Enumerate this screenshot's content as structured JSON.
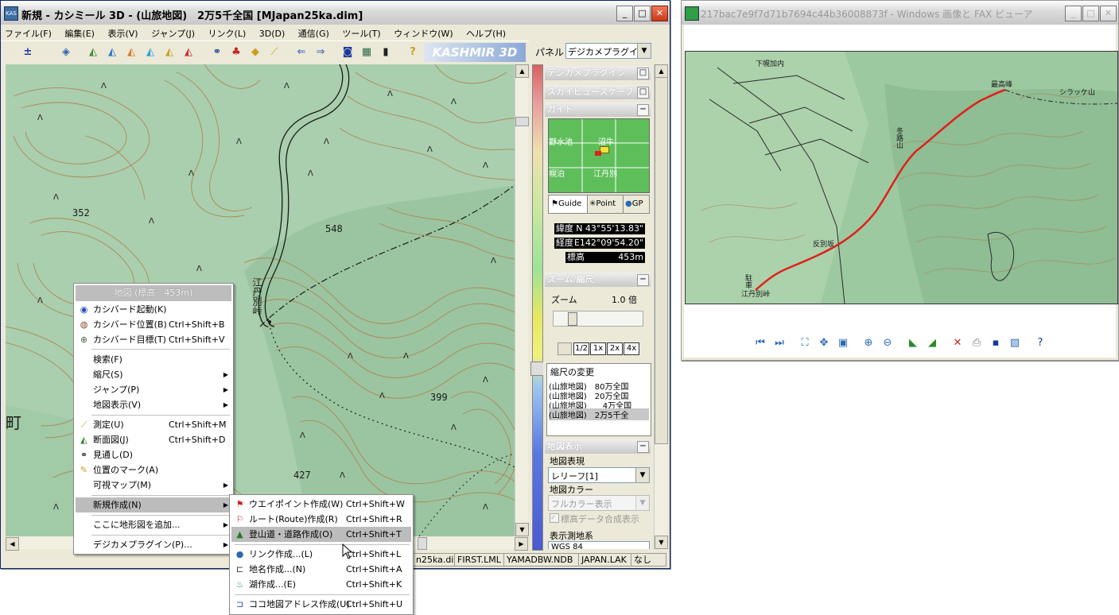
{
  "main_window": {
    "title": "新規 - カシミール 3D - (山旅地図)　2万5千全国 [MJapan25ka.dim]",
    "app_icon_text": "KAS",
    "menu": [
      "ファイル(F)",
      "編集(E)",
      "表示(V)",
      "ジャンプ(J)",
      "リンク(L)",
      "3D(D)",
      "通信(G)",
      "ツール(T)",
      "ウィンドウ(W)",
      "ヘルプ(H)"
    ],
    "brand": "KASHMIR 3D",
    "panel_label": "パネル",
    "panel_select": "デジカメプラグイ"
  },
  "map": {
    "labels": {
      "elev_352": "352",
      "elev_548": "548",
      "elev_399": "399",
      "elev_427": "427",
      "pass_name": "江丹別峠",
      "town": "町"
    }
  },
  "context_menu": {
    "header": "地図 (標高　453m)",
    "items": [
      {
        "label": "カシバード起動(K)",
        "shortcut": "",
        "icon": "bird-icon"
      },
      {
        "label": "カシバード位置(B)",
        "shortcut": "Ctrl+Shift+B",
        "icon": "camera-icon"
      },
      {
        "label": "カシバード目標(T)",
        "shortcut": "Ctrl+Shift+V",
        "icon": "target-icon"
      },
      {
        "label": "検索(F)",
        "shortcut": "",
        "icon": ""
      },
      {
        "label": "縮尺(S)",
        "shortcut": "",
        "icon": ""
      },
      {
        "label": "ジャンプ(P)",
        "shortcut": "",
        "icon": ""
      },
      {
        "label": "地図表示(V)",
        "shortcut": "",
        "icon": ""
      },
      {
        "label": "測定(U)",
        "shortcut": "Ctrl+Shift+M",
        "icon": "ruler-icon"
      },
      {
        "label": "断面図(J)",
        "shortcut": "Ctrl+Shift+D",
        "icon": "profile-icon"
      },
      {
        "label": "見通し(D)",
        "shortcut": "",
        "icon": "binoculars-icon"
      },
      {
        "label": "位置のマーク(A)",
        "shortcut": "",
        "icon": "pencil-icon"
      },
      {
        "label": "可視マップ(M)",
        "shortcut": "",
        "icon": ""
      },
      {
        "label": "新規作成(N)",
        "shortcut": "",
        "icon": ""
      },
      {
        "label": "ここに地形図を追加...",
        "shortcut": "",
        "icon": ""
      },
      {
        "label": "デジカメプラグイン(P)...",
        "shortcut": "",
        "icon": ""
      }
    ]
  },
  "submenu": {
    "items": [
      {
        "label": "ウエイポイント作成(W)",
        "shortcut": "Ctrl+Shift+W"
      },
      {
        "label": "ルート(Route)作成(R)",
        "shortcut": "Ctrl+Shift+R"
      },
      {
        "label": "登山道・道路作成(O)",
        "shortcut": "Ctrl+Shift+T"
      },
      {
        "label": "リンク作成...(L)",
        "shortcut": "Ctrl+Shift+L"
      },
      {
        "label": "地名作成...(N)",
        "shortcut": "Ctrl+Shift+A"
      },
      {
        "label": "湖作成...(E)",
        "shortcut": "Ctrl+Shift+K"
      },
      {
        "label": "ココ地図アドレス作成(U)",
        "shortcut": "Ctrl+Shift+U"
      }
    ]
  },
  "side_panel": {
    "headers": [
      "デジカメプラグイン",
      "スカイビュースケープ",
      "ガイド"
    ],
    "guide_places": {
      "nw": "野水池",
      "n": "沼牛",
      "sw": "幌泊",
      "s": "江丹別"
    },
    "tabs": [
      "Guide",
      "Point",
      "GP"
    ],
    "lat_label": "緯度",
    "lat_value": "N 43°55'13.83\"",
    "lon_label": "経度",
    "lon_value": "E142°09'54.20\"",
    "elev_label": "標高",
    "elev_value": "453m",
    "zoom_header": "ズーム/縮尺",
    "zoom_label": "ズーム",
    "zoom_value": "1.0 倍",
    "zoom_buttons": [
      "1/2",
      "1x",
      "2x",
      "4x"
    ],
    "scale_change_label": "縮尺の変更",
    "scale_list": [
      "(山旅地図)　80万全国",
      "(山旅地図)　20万全国",
      "(山旅地図)　　4万全国",
      "(山旅地図)　2万5千全"
    ],
    "mapdisp_header": "地図表示",
    "expression_label": "地図表現",
    "expression_value": "レリーフ[1]",
    "color_label": "地図カラー",
    "color_value": "フルカラー表示",
    "elev_blend_label": "標高データ合成表示",
    "datum_label": "表示測地系",
    "datum_value": "WGS 84"
  },
  "status_bar": [
    "n25ka.dim",
    "FIRST.LML",
    "YAMADBW.NDB",
    "JAPAN.LAK",
    "なし"
  ],
  "viewer_window": {
    "title": "217bac7e9f7d71b7694c44b36008873f - Windows 画像と FAX ビューア",
    "map_labels": {
      "peak": "最高峰",
      "shirakke": "シラッケ山",
      "fuyu": "冬路山",
      "shimohoro": "下幌加内",
      "tanbetsu": "江丹別峠",
      "chusha": "駐車",
      "hanbetsu": "反別坂"
    }
  },
  "colors": {
    "route": "#e0201a",
    "map_green": "#a9cfae",
    "contour": "#b07a4a"
  }
}
